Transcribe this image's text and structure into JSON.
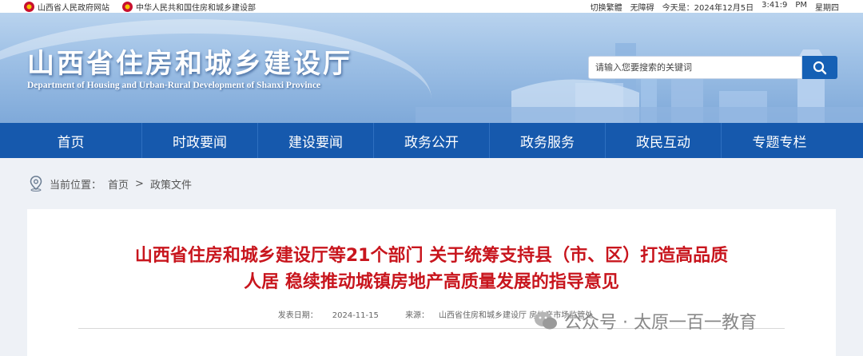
{
  "topbar": {
    "links": [
      "山西省人民政府网站",
      "中华人民共和国住房和城乡建设部"
    ],
    "right": [
      "切换繁體",
      "无障碍",
      "今天是：2024年12月5日",
      "3:41:9",
      "PM",
      "星期四"
    ]
  },
  "header": {
    "title": "山西省住房和城乡建设厅",
    "subtitle": "Department of Housing and Urban-Rural Development of Shanxi Province",
    "search_placeholder": "请输入您要搜索的关键词"
  },
  "nav": [
    "首页",
    "时政要闻",
    "建设要闻",
    "政务公开",
    "政务服务",
    "政民互动",
    "专题专栏"
  ],
  "breadcrumb": {
    "label": "当前位置：",
    "items": [
      "首页",
      "政策文件"
    ],
    "separator": ">"
  },
  "article": {
    "title_line1": "山西省住房和城乡建设厅等21个部门 关于统筹支持县（市、区）打造高品质",
    "title_line2": "人居 稳续推动城镇房地产高质量发展的指导意见",
    "date_label": "发表日期：",
    "date": "2024-11-15",
    "source_label": "来源：",
    "source": "山西省住房和城乡建设厅 房地产市场监管处"
  },
  "watermark": "公众号 · 太原一百一教育",
  "colors": {
    "nav_bg": "#1659ad",
    "title_red": "#c8151d",
    "search_button": "#1560b5"
  }
}
